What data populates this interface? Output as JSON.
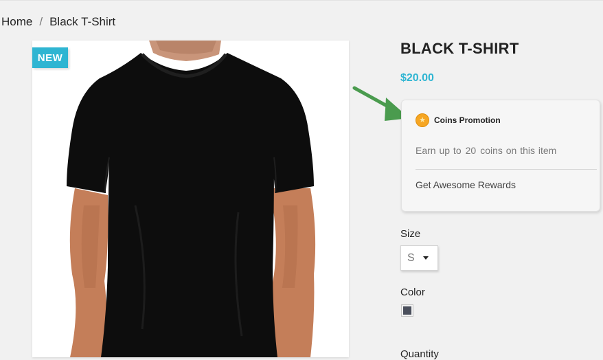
{
  "breadcrumb": {
    "home": "Home",
    "separator": "/",
    "current": "Black T-Shirt"
  },
  "product": {
    "badge": "NEW",
    "title": "BLACK T-SHIRT",
    "price": "$20.00",
    "image_icon": "black-tshirt-image"
  },
  "promotion": {
    "title": "Coins Promotion",
    "text_prefix": "Earn up to",
    "coins": "20",
    "text_suffix": "coins on this item",
    "rewards_link": "Get Awesome Rewards",
    "icon": "coin-icon"
  },
  "options": {
    "size_label": "Size",
    "size_value": "S",
    "color_label": "Color",
    "color_value": "#4a4f5c",
    "quantity_label": "Quantity"
  },
  "colors": {
    "accent": "#2fb5d2",
    "arrow": "#4a9b4e"
  }
}
